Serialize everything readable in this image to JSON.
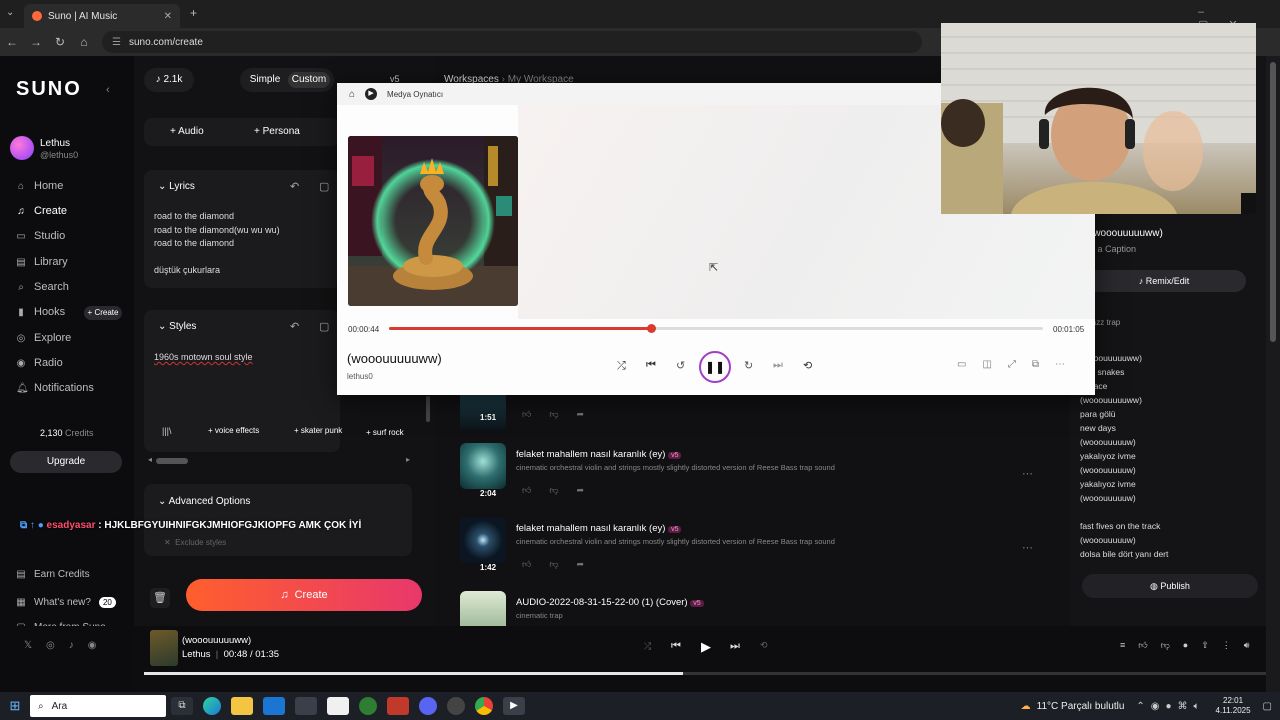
{
  "browser": {
    "tab_title": "Suno | AI Music",
    "url": "suno.com/create"
  },
  "sidebar": {
    "logo": "SUNO",
    "user": {
      "name": "Lethus",
      "handle": "@lethus0"
    },
    "items": [
      {
        "label": "Home",
        "icon": "home-icon"
      },
      {
        "label": "Create",
        "icon": "create-icon"
      },
      {
        "label": "Studio",
        "icon": "studio-icon"
      },
      {
        "label": "Library",
        "icon": "library-icon"
      },
      {
        "label": "Search",
        "icon": "search-icon"
      },
      {
        "label": "Hooks",
        "icon": "hooks-icon"
      },
      {
        "label": "Explore",
        "icon": "explore-icon"
      },
      {
        "label": "Radio",
        "icon": "radio-icon"
      },
      {
        "label": "Notifications",
        "icon": "bell-icon"
      }
    ],
    "hooks_create": "+ Create",
    "credits_value": "2,130",
    "credits_label": "Credits",
    "upgrade": "Upgrade",
    "earn_credits": "Earn Credits",
    "whats_new": "What's new?",
    "whats_new_badge": "20",
    "more_from_suno": "More from Suno"
  },
  "create": {
    "likes": "2.1k",
    "mode_simple": "Simple",
    "mode_custom": "Custom",
    "version": "v5",
    "audio_btn": "Audio",
    "persona_btn": "Persona",
    "lyrics_title": "Lyrics",
    "lyrics_lines": [
      "road to the diamond",
      "road to the diamond(wu wu wu)",
      "road to the diamond",
      "",
      "düştük çukurlara"
    ],
    "styles_title": "Styles",
    "styles_value": "1960s motown soul style",
    "tags": [
      "voice effects",
      "skater punk",
      "surf rock"
    ],
    "advanced": "Advanced Options",
    "exclude_placeholder": "Exclude styles",
    "create_btn": "Create"
  },
  "chat_overlay": {
    "user": "esadyasar",
    "message": ": HJKLBFGYUIHNIFGKJMHIOFGJKIOPFG AMK ÇOK İYİ"
  },
  "main": {
    "breadcrumb_root": "Workspaces",
    "breadcrumb_current": "My Workspace",
    "songs": [
      {
        "duration": "1:51",
        "title": "",
        "desc": "",
        "badge": ""
      },
      {
        "duration": "2:04",
        "title": "felaket mahallem nasıl karanlık (ey)",
        "badge": "v5",
        "desc": "cinematic orchestral violin and strings mostly slightly distorted version of Reese Bass trap sound"
      },
      {
        "duration": "1:42",
        "title": "felaket mahallem nasıl karanlık (ey)",
        "badge": "v5",
        "desc": "cinematic orchestral violin and strings mostly slightly distorted version of Reese Bass trap sound"
      },
      {
        "duration": "",
        "title": "AUDIO-2022-08-31-15-22-00 (1) (Cover)",
        "badge": "v5",
        "desc": "cinematic trap"
      }
    ]
  },
  "right": {
    "title": "(wooouuuuuww)",
    "caption": "d a Caption",
    "remix": "Remix/Edit",
    "genre": "jazz trap",
    "lyrics": [
      "(wooouuuuuww)",
      "ucci snakes",
      "ith face",
      "(wooouuuuuww)",
      "para gölü",
      "new days",
      "(wooouuuuuw)",
      "yakalıyoz ivme",
      "(wooouuuuuw)",
      "yakalıyoz ivme",
      "(wooouuuuuw)",
      "",
      "fast fives on the track",
      "(wooouuuuuw)",
      "dolsa bile dört yanı dert"
    ],
    "publish": "Publish"
  },
  "media_player": {
    "app_name": "Medya Oynatıcı",
    "elapsed": "00:00:44",
    "total": "00:01:05",
    "progress": 0.4,
    "track_title": "(wooouuuuuww)",
    "track_artist": "lethus0"
  },
  "bottom_player": {
    "title": "(wooouuuuuww)",
    "artist": "Lethus",
    "time": "00:48 /  01:35",
    "progress": 0.48
  },
  "taskbar": {
    "search": "Ara",
    "weather": "11°C  Parçalı bulutlu",
    "time": "22:01",
    "date": "4.11.2025"
  },
  "colors": {
    "accent": "#ff6a3d",
    "create_gradient_start": "#ff5f2d",
    "create_gradient_end": "#e8386b",
    "progress_red": "#d93b2f",
    "badge_pink": "#b22a7a"
  }
}
